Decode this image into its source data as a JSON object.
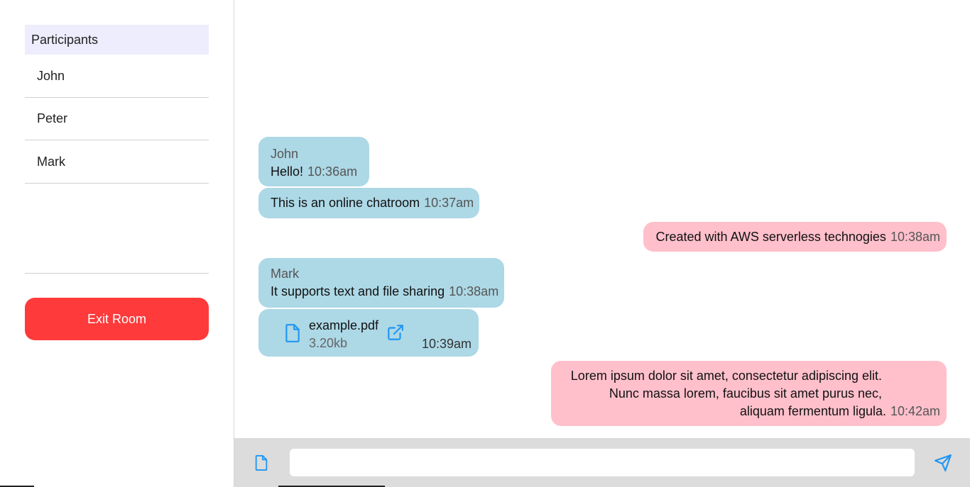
{
  "sidebar": {
    "header": "Participants",
    "participants": [
      "John",
      "Peter",
      "Mark"
    ],
    "exit_label": "Exit Room"
  },
  "messages": [
    {
      "direction": "in",
      "sender": "John",
      "text": "Hello!",
      "time": "10:36am"
    },
    {
      "direction": "in",
      "text": "This is an online chatroom",
      "time": "10:37am"
    },
    {
      "direction": "out",
      "text": "Created with AWS serverless technogies",
      "time": "10:38am"
    },
    {
      "direction": "in",
      "sender": "Mark",
      "text": "It supports text and file sharing",
      "time": "10:38am"
    },
    {
      "direction": "in",
      "type": "file",
      "file_name": "example.pdf",
      "file_size": "3.20kb",
      "time": "10:39am"
    },
    {
      "direction": "out",
      "lines": [
        "Lorem ipsum dolor sit amet, consectetur adipiscing elit.",
        "Nunc massa lorem, faucibus sit amet purus nec,",
        "aliquam fermentum ligula."
      ],
      "time": "10:42am"
    }
  ],
  "composer": {
    "input_value": "",
    "input_placeholder": ""
  },
  "colors": {
    "incoming_bubble": "#add8e6",
    "outgoing_bubble": "#ffc0cb",
    "exit_button": "#fe3a3b",
    "participants_header": "#eeedfd",
    "composer_bar": "#dcdcdc",
    "icon_accent": "#2196f3"
  },
  "icons": {
    "attach": "file-icon",
    "send": "send-icon",
    "file": "file-icon",
    "open": "external-link-icon"
  }
}
